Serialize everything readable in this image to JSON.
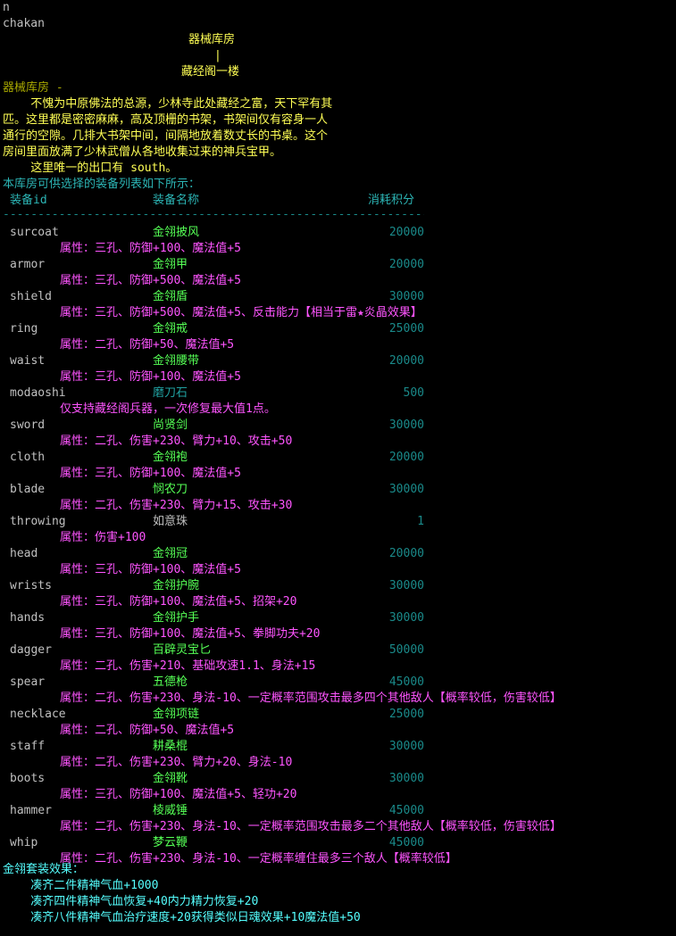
{
  "console": {
    "cmd1": "n",
    "cmd2": "chakan",
    "map_top": "器械库房",
    "map_link": "|",
    "map_bottom": "藏经阁一楼",
    "room_title": "器械库房 -",
    "desc_lines": [
      "    不愧为中原佛法的总源，少林寺此处藏经之富，天下罕有其",
      "匹。这里都是密密麻麻，高及顶栅的书架，书架间仅有容身一人",
      "通行的空隙。几排大书架中间，间隔地放着数丈长的书桌。这个",
      "房间里面放满了少林武僧从各地收集过来的神兵宝甲。",
      "    这里唯一的出口有 south。"
    ],
    "list_intro": "本库房可供选择的装备列表如下所示：",
    "headers": {
      "id": "装备id",
      "name": "装备名称",
      "cost": "消耗积分"
    },
    "divider": "--------------------------------------------------------------------",
    "items": [
      {
        "id": "surcoat",
        "name": "金翎披风",
        "cost": "20000",
        "attr": "属性：三孔、防御+100、魔法值+5"
      },
      {
        "id": "armor",
        "name": "金翎甲",
        "cost": "20000",
        "attr": "属性：三孔、防御+500、魔法值+5"
      },
      {
        "id": "shield",
        "name": "金翎盾",
        "cost": "30000",
        "attr": "属性：三孔、防御+500、魔法值+5、反击能力【相当于雷★炎晶效果】"
      },
      {
        "id": "ring",
        "name": "金翎戒",
        "cost": "25000",
        "attr": "属性：二孔、防御+50、魔法值+5"
      },
      {
        "id": "waist",
        "name": "金翎腰带",
        "cost": "20000",
        "attr": "属性：三孔、防御+100、魔法值+5"
      },
      {
        "id": "modaoshi",
        "name": "磨刀石",
        "cost": "500",
        "attr": "仅支持藏经阁兵器，一次修复最大值1点。"
      },
      {
        "id": "sword",
        "name": "尚贤剑",
        "cost": "30000",
        "attr": "属性：二孔、伤害+230、臂力+10、攻击+50"
      },
      {
        "id": "cloth",
        "name": "金翎袍",
        "cost": "20000",
        "attr": "属性：三孔、防御+100、魔法值+5"
      },
      {
        "id": "blade",
        "name": "悯农刀",
        "cost": "30000",
        "attr": "属性：二孔、伤害+230、臂力+15、攻击+30"
      },
      {
        "id": "throwing",
        "name": "如意珠",
        "cost": "1",
        "attr": "属性：伤害+100"
      },
      {
        "id": "head",
        "name": "金翎冠",
        "cost": "20000",
        "attr": "属性：三孔、防御+100、魔法值+5"
      },
      {
        "id": "wrists",
        "name": "金翎护腕",
        "cost": "30000",
        "attr": "属性：三孔、防御+100、魔法值+5、招架+20"
      },
      {
        "id": "hands",
        "name": "金翎护手",
        "cost": "30000",
        "attr": "属性：三孔、防御+100、魔法值+5、拳脚功夫+20"
      },
      {
        "id": "dagger",
        "name": "百辟灵宝匕",
        "cost": "50000",
        "attr": "属性：二孔、伤害+210、基础攻速1.1、身法+15"
      },
      {
        "id": "spear",
        "name": "五德枪",
        "cost": "45000",
        "attr": "属性：二孔、伤害+230、身法-10、一定概率范围攻击最多四个其他敌人【概率较低，伤害较低】"
      },
      {
        "id": "necklace",
        "name": "金翎项链",
        "cost": "25000",
        "attr": "属性：二孔、防御+50、魔法值+5"
      },
      {
        "id": "staff",
        "name": "耕桑棍",
        "cost": "30000",
        "attr": "属性：二孔、伤害+230、臂力+20、身法-10"
      },
      {
        "id": "boots",
        "name": "金翎靴",
        "cost": "30000",
        "attr": "属性：三孔、防御+100、魔法值+5、轻功+20"
      },
      {
        "id": "hammer",
        "name": "棱威锤",
        "cost": "45000",
        "attr": "属性：二孔、伤害+230、身法-10、一定概率范围攻击最多二个其他敌人【概率较低，伤害较低】"
      },
      {
        "id": "whip",
        "name": "梦云鞭",
        "cost": "45000",
        "attr": "属性：二孔、伤害+230、身法-10、一定概率缠住最多三个敌人【概率较低】"
      }
    ],
    "set_title": "金翎套装效果：",
    "set_lines": [
      "    凑齐二件精神气血+1000",
      "    凑齐四件精神气血恢复+40内力精力恢复+20",
      "    凑齐八件精神气血治疗速度+20获得类似日魂效果+10魔法值+50"
    ]
  }
}
